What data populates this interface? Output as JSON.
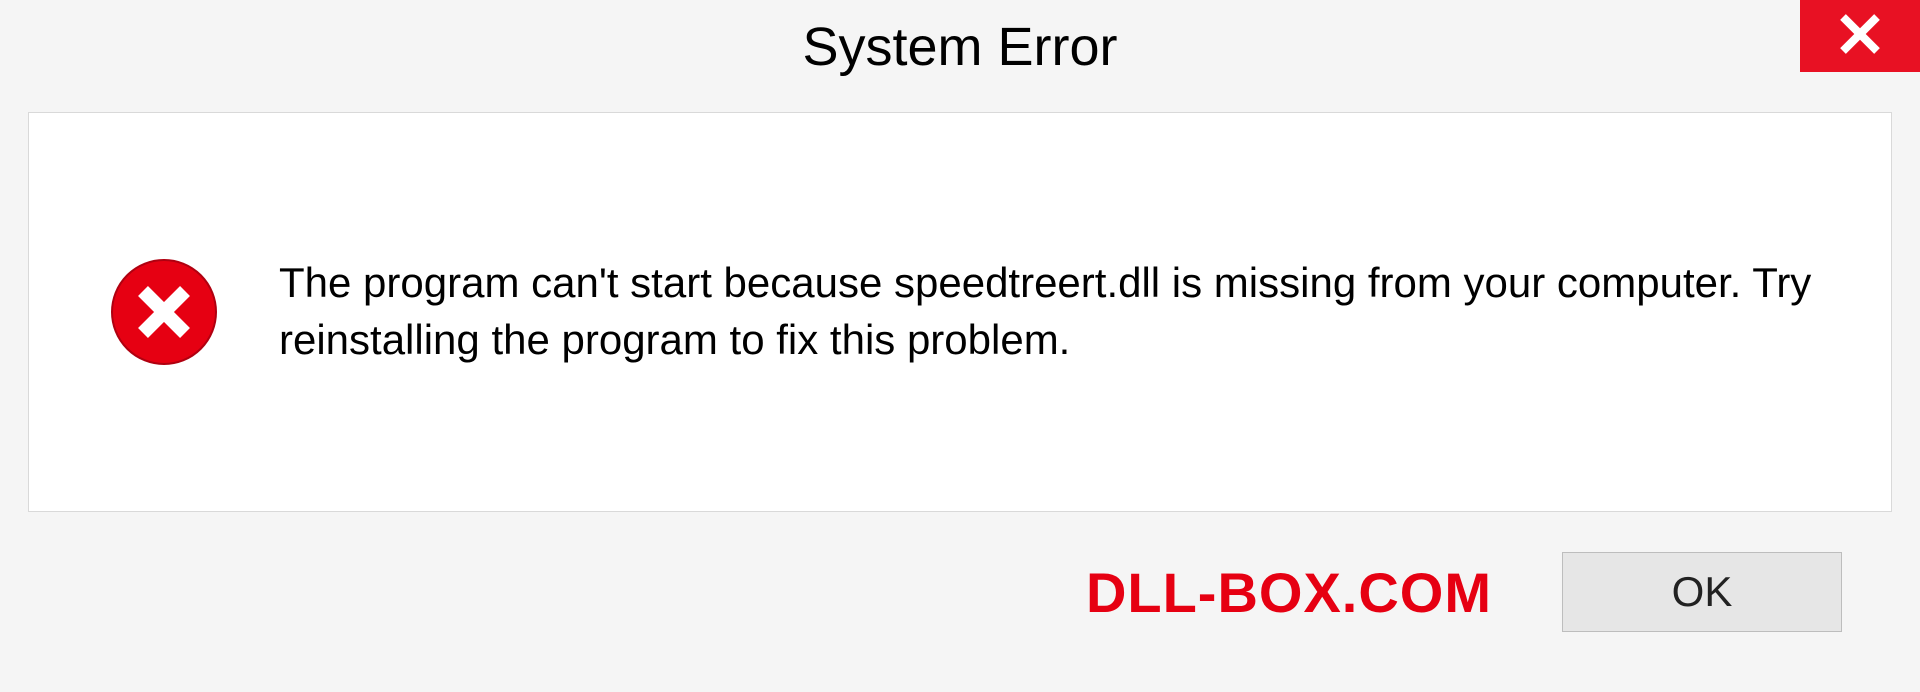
{
  "dialog": {
    "title": "System Error",
    "message": "The program can't start because speedtreert.dll is missing from your computer. Try reinstalling the program to fix this problem.",
    "ok_label": "OK"
  },
  "watermark": "DLL-BOX.COM"
}
